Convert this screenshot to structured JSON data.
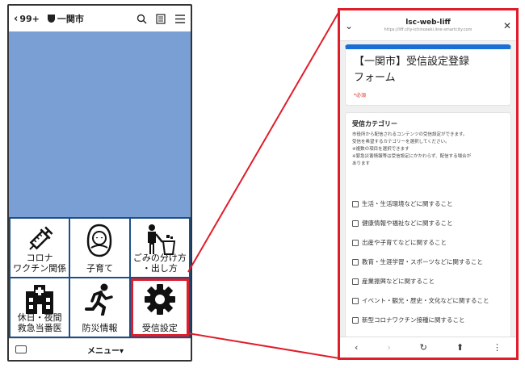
{
  "phone": {
    "back_count": "99+",
    "room_name": "一関市",
    "menu_toggle": "メニュー▾",
    "tiles": [
      {
        "label": "コロナ\nワクチン関係",
        "icon": "syringe-icon"
      },
      {
        "label": "子育て",
        "icon": "baby-icon"
      },
      {
        "label": "ごみの分け方\n・出し方",
        "icon": "trash-sorting-icon"
      },
      {
        "label": "休日・夜間\n救急当番医",
        "icon": "hospital-icon"
      },
      {
        "label": "防災情報",
        "icon": "running-person-icon"
      },
      {
        "label": "受信設定",
        "icon": "gear-icon"
      }
    ]
  },
  "webview": {
    "title": "lsc-web-liff",
    "url": "https://liff.city-ichinoseki.line-smartcity.com",
    "form_title_line1": "【一関市】受信設定登録",
    "form_title_line2": "フォーム",
    "required_note": "*必須",
    "question": {
      "title": "受信カテゴリー",
      "desc1": "市役所から配信されるコンテンツの受信設定ができます。",
      "desc2": "受信を希望するカテゴリーを選択してください。",
      "desc3": "※複数の項目を選択できます",
      "desc4": "※緊急災害情報等は受信設定にかかわらず、配信する場合が",
      "desc5": "あります",
      "options": [
        "生活・生活環境などに関すること",
        "健康情報や福祉などに関すること",
        "出産や子育てなどに関すること",
        "教育・生涯学習・スポーツなどに関すること",
        "産業振興などに関すること",
        "イベント・観光・歴史・文化などに関すること",
        "新型コロナワクチン接種に関すること"
      ]
    }
  },
  "colors": {
    "highlight": "#e01d2b",
    "chat_bg": "#7a9fd4",
    "grid_border": "#1d4f86",
    "form_accent": "#1a6fd6"
  }
}
